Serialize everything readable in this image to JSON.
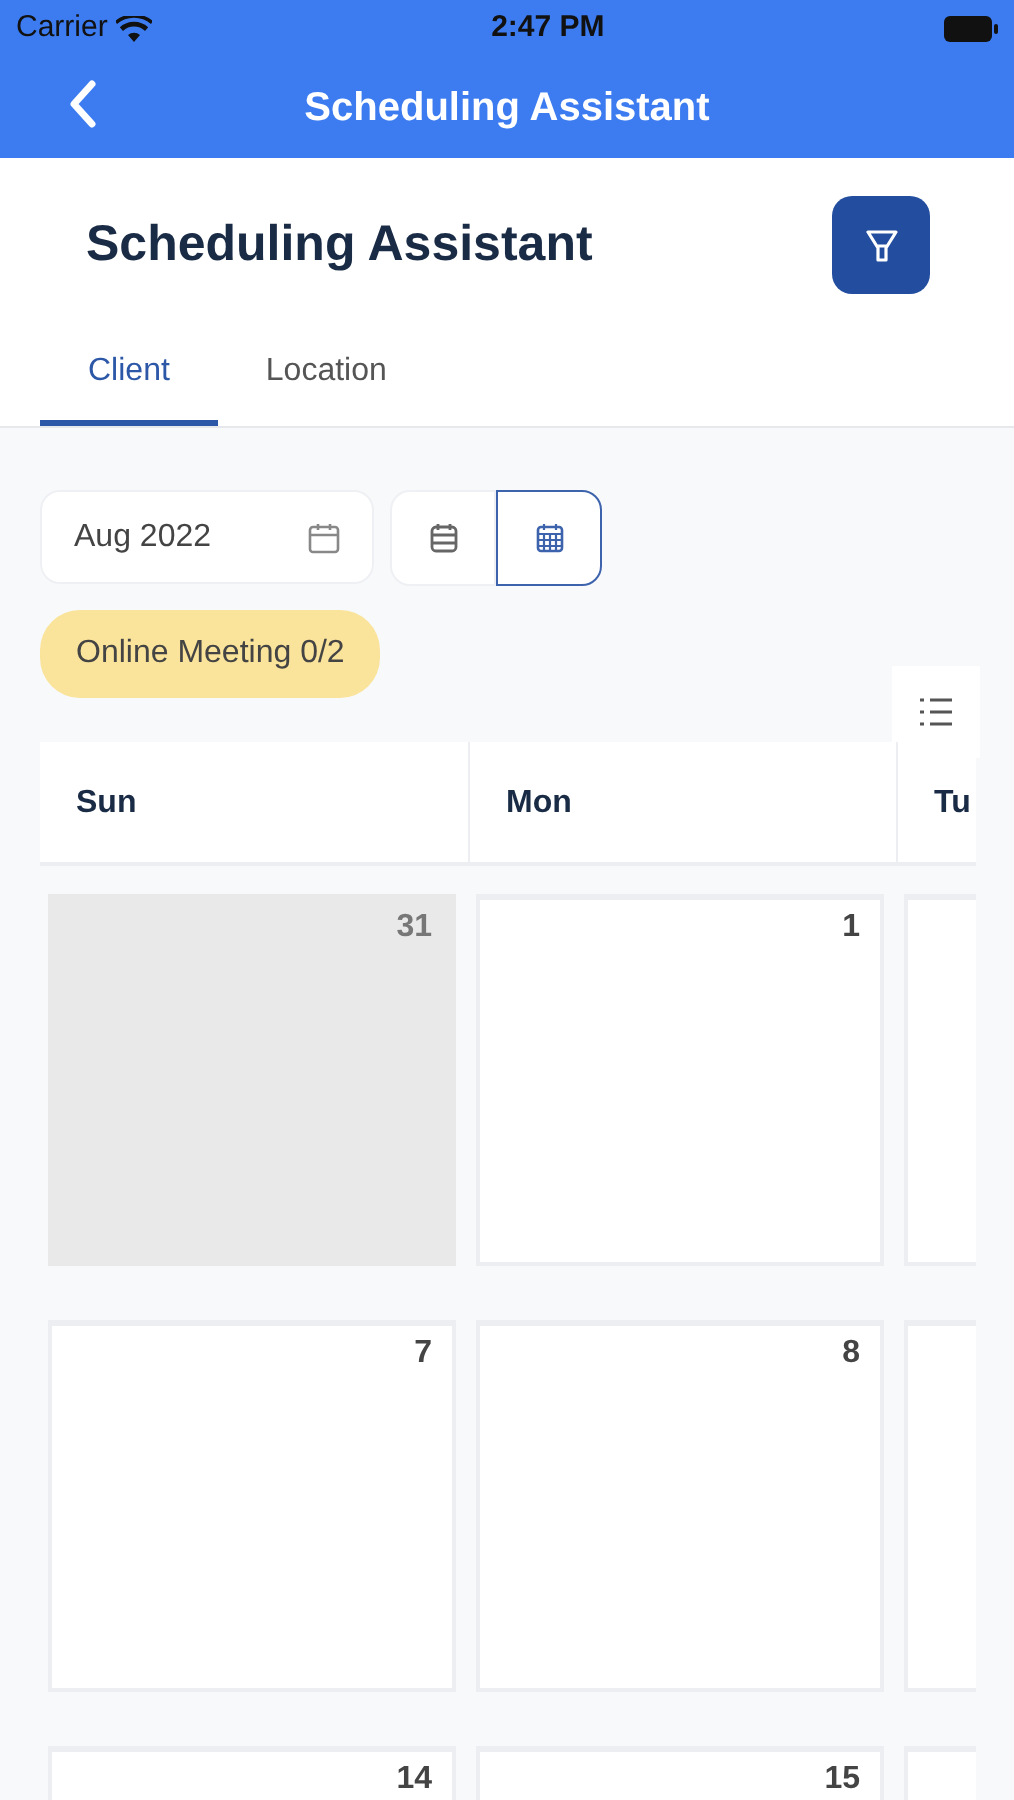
{
  "status_bar": {
    "carrier": "Carrier",
    "time": "2:47 PM"
  },
  "nav_bar": {
    "title": "Scheduling Assistant"
  },
  "header": {
    "title": "Scheduling Assistant"
  },
  "tabs": [
    {
      "label": "Client",
      "selected": true
    },
    {
      "label": "Location",
      "selected": false
    }
  ],
  "month_field": {
    "value": "Aug 2022"
  },
  "view_toggle": [
    {
      "kind": "week",
      "selected": false
    },
    {
      "kind": "month",
      "selected": true
    }
  ],
  "chip": {
    "label": "Online Meeting 0/2"
  },
  "calendar": {
    "days": [
      "Sun",
      "Mon",
      "Tu"
    ],
    "weeks": [
      [
        {
          "day": "31",
          "outside": true
        },
        {
          "day": "1",
          "outside": false
        },
        {
          "outside": false
        }
      ],
      [
        {
          "day": "7",
          "outside": false
        },
        {
          "day": "8",
          "outside": false
        },
        {
          "outside": false
        }
      ],
      [
        {
          "day": "14",
          "outside": false
        },
        {
          "day": "15",
          "outside": false
        },
        {
          "outside": false
        }
      ]
    ]
  }
}
